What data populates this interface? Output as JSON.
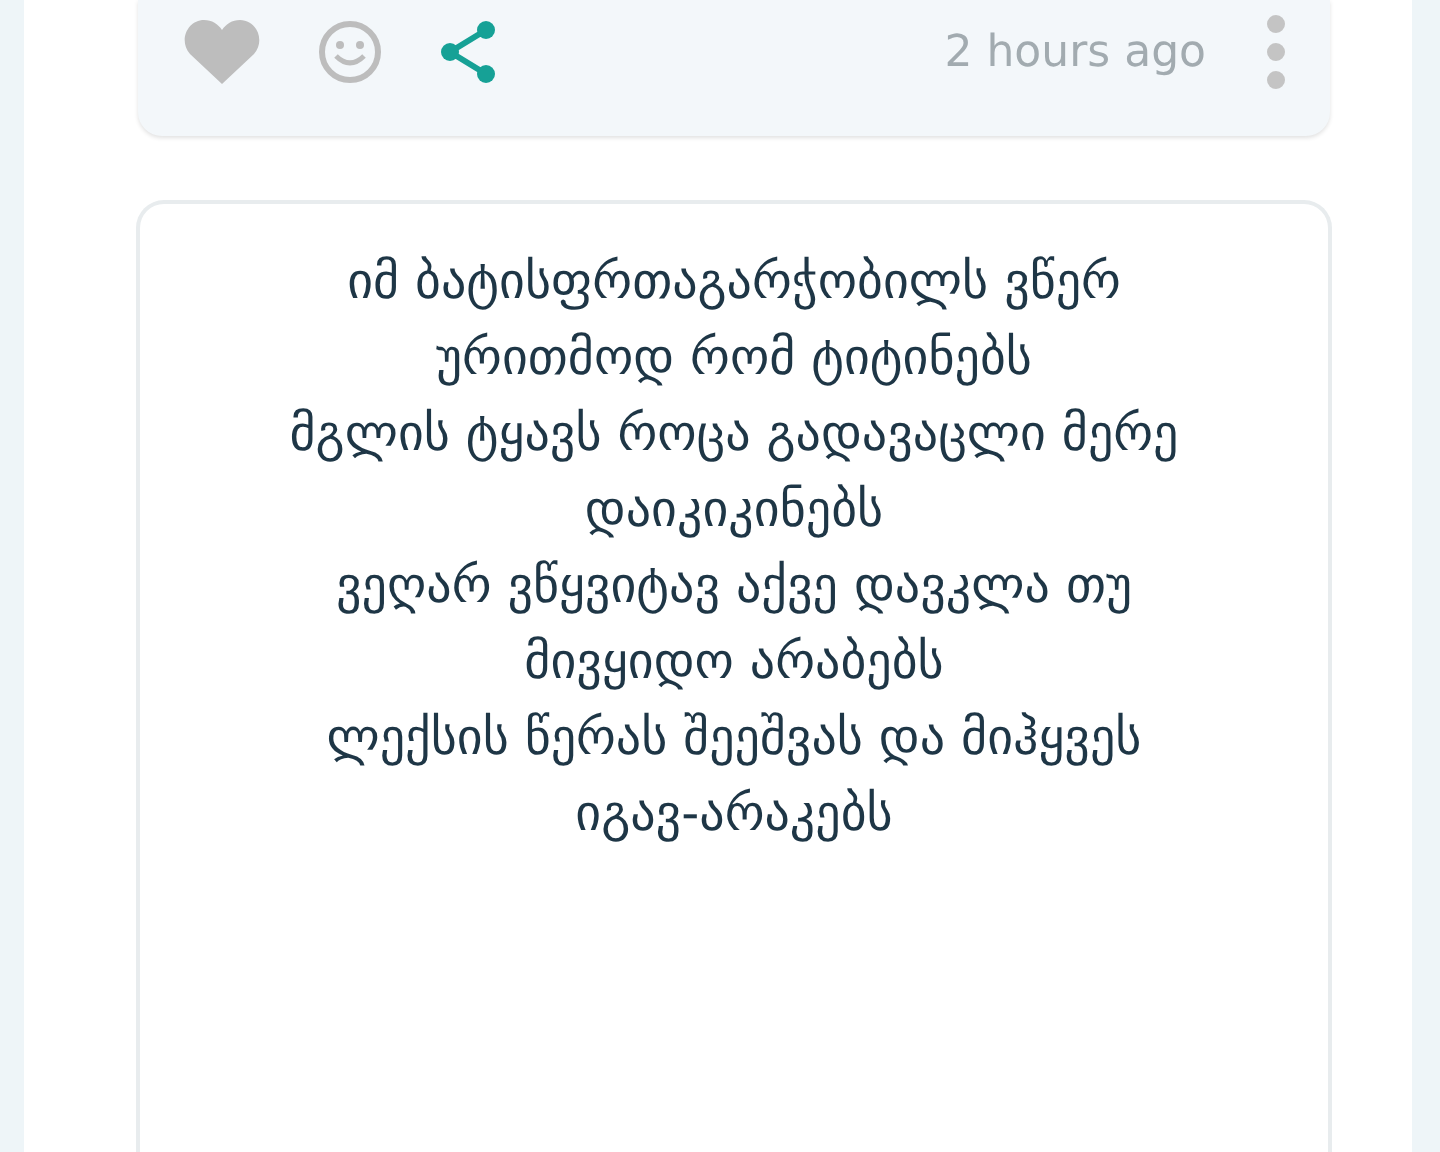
{
  "post_footer": {
    "liked": false,
    "time": "2 hours ago"
  },
  "poem": {
    "lines": [
      "იმ ბატისფრთაგარჭობილს ვწერ ურითმოდ რომ ტიტინებს",
      "მგლის ტყავს როცა გადავაცლი მერე დაიკიკინებს",
      "ვეღარ ვწყვიტავ აქვე დავკლა თუ მივყიდო არაბებს",
      "ლექსის წერას შეეშვას და მიჰყვეს იგავ-არაკებს"
    ]
  }
}
